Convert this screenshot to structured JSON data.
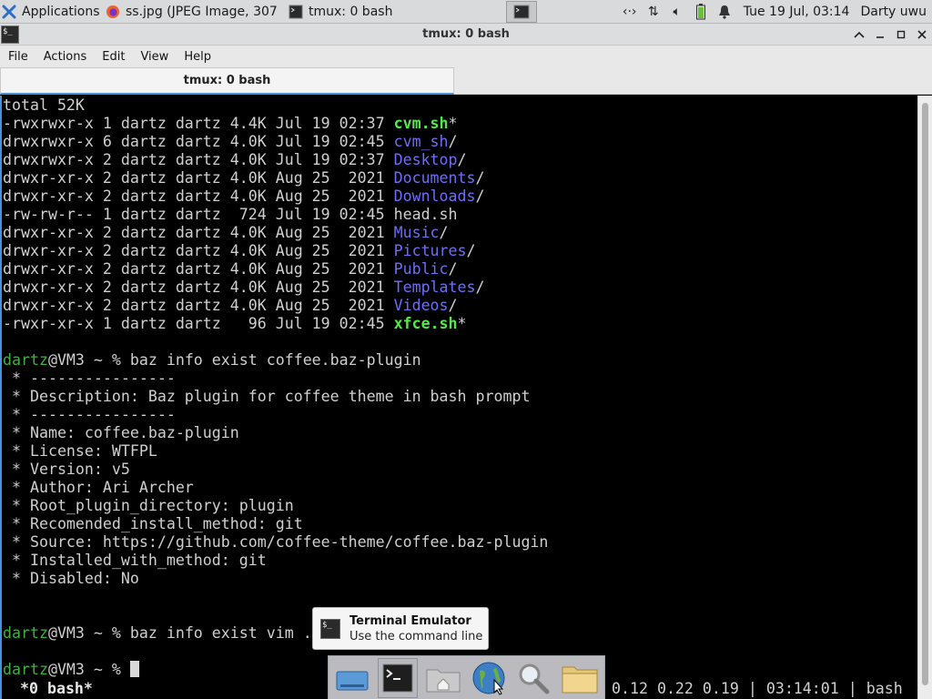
{
  "top_panel": {
    "apps_label": "Applications",
    "tasks": [
      {
        "label": "ss.jpg (JPEG Image, 307...",
        "icon": "firefox-icon"
      },
      {
        "label": "tmux: 0 bash",
        "icon": "terminal-icon"
      }
    ],
    "clock": "Tue 19 Jul, 03:14",
    "user": "Darty uwu",
    "colors": {
      "panel_bg": "#d9dadc",
      "accent": "#4a90d9"
    }
  },
  "window": {
    "title": "tmux: 0 bash",
    "menu": [
      "File",
      "Actions",
      "Edit",
      "View",
      "Help"
    ],
    "tab_label": "tmux: 0 bash"
  },
  "terminal": {
    "total_line": "total 52K",
    "listing": [
      {
        "perms": "-rwxrwxr-x 1 dartz dartz 4.4K Jul 19 02:37 ",
        "name": "cvm.sh",
        "suffix": "*",
        "kind": "exec"
      },
      {
        "perms": "drwxrwxr-x 6 dartz dartz 4.0K Jul 19 02:45 ",
        "name": "cvm_sh",
        "suffix": "/",
        "kind": "dir"
      },
      {
        "perms": "drwxrwxr-x 2 dartz dartz 4.0K Jul 19 02:37 ",
        "name": "Desktop",
        "suffix": "/",
        "kind": "dir"
      },
      {
        "perms": "drwxr-xr-x 2 dartz dartz 4.0K Aug 25  2021 ",
        "name": "Documents",
        "suffix": "/",
        "kind": "dir"
      },
      {
        "perms": "drwxr-xr-x 2 dartz dartz 4.0K Aug 25  2021 ",
        "name": "Downloads",
        "suffix": "/",
        "kind": "dir"
      },
      {
        "perms": "-rw-rw-r-- 1 dartz dartz  724 Jul 19 02:45 ",
        "name": "head.sh",
        "suffix": "",
        "kind": "file"
      },
      {
        "perms": "drwxr-xr-x 2 dartz dartz 4.0K Aug 25  2021 ",
        "name": "Music",
        "suffix": "/",
        "kind": "dir"
      },
      {
        "perms": "drwxr-xr-x 2 dartz dartz 4.0K Aug 25  2021 ",
        "name": "Pictures",
        "suffix": "/",
        "kind": "dir"
      },
      {
        "perms": "drwxr-xr-x 2 dartz dartz 4.0K Aug 25  2021 ",
        "name": "Public",
        "suffix": "/",
        "kind": "dir"
      },
      {
        "perms": "drwxr-xr-x 2 dartz dartz 4.0K Aug 25  2021 ",
        "name": "Templates",
        "suffix": "/",
        "kind": "dir"
      },
      {
        "perms": "drwxr-xr-x 2 dartz dartz 4.0K Aug 25  2021 ",
        "name": "Videos",
        "suffix": "/",
        "kind": "dir"
      },
      {
        "perms": "-rwxr-xr-x 1 dartz dartz   96 Jul 19 02:45 ",
        "name": "xfce.sh",
        "suffix": "*",
        "kind": "exec"
      }
    ],
    "prompt_user": "dartz",
    "prompt_rest": "@VM3 ~ % ",
    "command_1": "baz info exist coffee.baz-plugin",
    "info_lines": [
      " * ----------------",
      " * Description: Baz plugin for coffee theme in bash prompt",
      " * ----------------",
      " * Name: coffee.baz-plugin",
      " * License: WTFPL",
      " * Version: v5",
      " * Author: Ari Archer",
      " * Root_plugin_directory: plugin",
      " * Recomended_install_method: git",
      " * Source: https://github.com/coffee-theme/coffee.baz-plugin",
      " * Installed_with_method: git",
      " * Disabled: No"
    ],
    "command_2": "baz info exist vim .b",
    "status_left": " *0 bash*",
    "status_right": "0.12 0.22 0.19 | 03:14:01 | bash",
    "colors": {
      "exec": "#55e84a",
      "dir": "#6e6ef5",
      "prompt_user": "#3fb13f",
      "text": "#cfcfcf"
    }
  },
  "tooltip": {
    "title": "Terminal Emulator",
    "subtitle": "Use the command line"
  },
  "dock": {
    "items": [
      "drive-icon",
      "terminal-icon",
      "home-folder-icon",
      "web-browser-icon",
      "search-icon",
      "folder-icon"
    ]
  }
}
